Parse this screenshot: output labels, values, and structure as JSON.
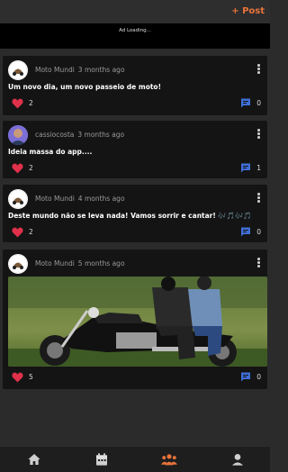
{
  "header": {
    "post_label": "+ Post"
  },
  "ad": {
    "text": "Ad Loading..."
  },
  "posts": [
    {
      "author": "Moto Mundi",
      "time": "3 months ago",
      "text": "Um novo dia, um novo passeio de moto!",
      "likes": "2",
      "comments": "0"
    },
    {
      "author": "cassiocosta",
      "time": "3 months ago",
      "text": "Ideia massa do app....",
      "likes": "2",
      "comments": "1"
    },
    {
      "author": "Moto Mundi",
      "time": "4 months ago",
      "text": "Deste mundo não se leva nada! Vamos sorrir e cantar!",
      "emoji": "🎶🎵🎶🎵",
      "likes": "2",
      "comments": "0"
    },
    {
      "author": "Moto Mundi",
      "time": "5 months ago",
      "likes": "5",
      "comments": "0"
    }
  ],
  "colors": {
    "accent": "#e8743b",
    "heart": "#e0314b",
    "comment": "#3f6fd8",
    "nav_active": "#e8743b",
    "nav_inactive": "#cfcfcf"
  },
  "nav": {
    "items": [
      {
        "icon": "home-icon"
      },
      {
        "icon": "calendar-icon"
      },
      {
        "icon": "community-icon",
        "active": true
      },
      {
        "icon": "profile-icon"
      }
    ]
  }
}
